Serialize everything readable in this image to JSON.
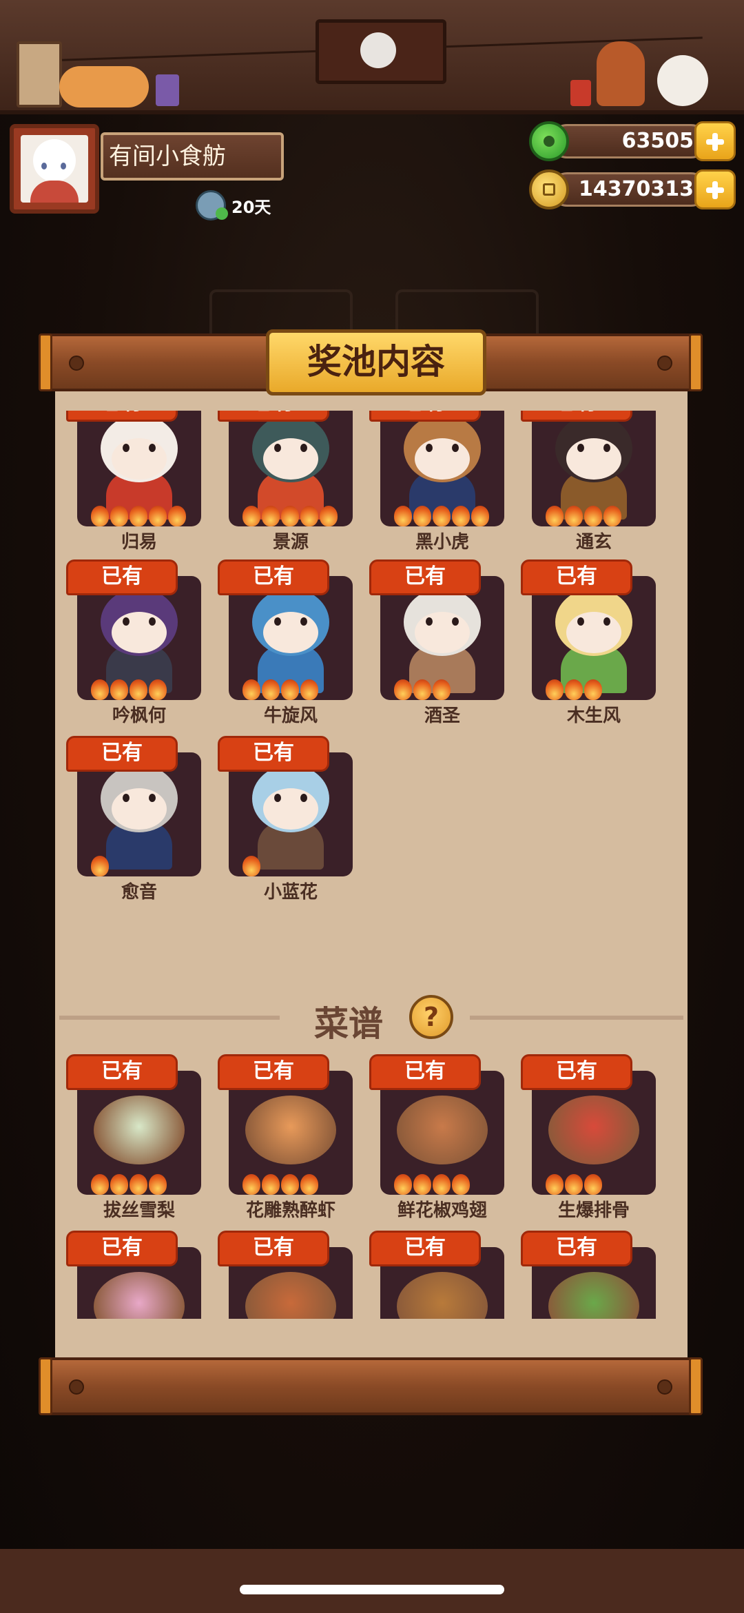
{
  "shop": {
    "name": "有间小食舫",
    "days": "20天"
  },
  "currency": {
    "jade": "63505",
    "coins": "14370313"
  },
  "panel": {
    "title": "奖池内容",
    "owned_label": "已有"
  },
  "characters": [
    {
      "name": "归易",
      "flames": 5,
      "color": "#f3ece6",
      "body": "#c83a2a"
    },
    {
      "name": "景源",
      "flames": 5,
      "color": "#3e5a5a",
      "body": "#d24a2a"
    },
    {
      "name": "黑小虎",
      "flames": 5,
      "color": "#b87a44",
      "body": "#2a3a6a"
    },
    {
      "name": "通玄",
      "flames": 4,
      "color": "#3a2a2a",
      "body": "#8a5a2a"
    },
    {
      "name": "吟枫何",
      "flames": 4,
      "color": "#5a3a7a",
      "body": "#3a3a4a"
    },
    {
      "name": "牛旋风",
      "flames": 4,
      "color": "#4a90c8",
      "body": "#3a7ab8"
    },
    {
      "name": "酒圣",
      "flames": 3,
      "color": "#e6e2dc",
      "body": "#a87a5a"
    },
    {
      "name": "木生风",
      "flames": 3,
      "color": "#f0d68a",
      "body": "#6aa84a"
    },
    {
      "name": "愈音",
      "flames": 1,
      "color": "#c8c4c0",
      "body": "#2a3a6a"
    },
    {
      "name": "小蓝花",
      "flames": 1,
      "color": "#a8cfe6",
      "body": "#6a4a3a"
    }
  ],
  "recipes_section": {
    "title": "菜谱",
    "help": "?"
  },
  "recipes": [
    {
      "name": "拔丝雪梨",
      "flames": 4,
      "color": "#d8e8c8"
    },
    {
      "name": "花雕熟醉虾",
      "flames": 4,
      "color": "#e89a5a"
    },
    {
      "name": "鲜花椒鸡翅",
      "flames": 4,
      "color": "#c87a4a"
    },
    {
      "name": "生爆排骨",
      "flames": 3,
      "color": "#d84a3a"
    },
    {
      "name": "",
      "flames": 0,
      "color": "#e8a8c8"
    },
    {
      "name": "",
      "flames": 0,
      "color": "#c86a3a"
    },
    {
      "name": "",
      "flames": 0,
      "color": "#b87a3a"
    },
    {
      "name": "",
      "flames": 0,
      "color": "#6aa84a"
    }
  ],
  "colors": {
    "owned_badge": "#d84114",
    "paper": "#d5bc9f",
    "accent_gold": "#e9a92a"
  }
}
